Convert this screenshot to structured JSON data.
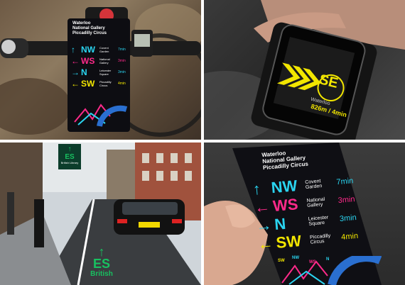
{
  "panel_bike": {
    "route": [
      "Waterloo",
      "National Gallery",
      "Piccadilly Circus"
    ],
    "directions": [
      {
        "arrow": "up-arrow",
        "code": "NW",
        "dest": "Covent Garden",
        "time": "7min",
        "color": "#2ad4f0"
      },
      {
        "arrow": "left-arrow",
        "code": "WS",
        "dest": "National Gallery",
        "time": "3min",
        "color": "#ff2a8a"
      },
      {
        "arrow": "right-arrow",
        "code": "N",
        "dest": "Leicester Square",
        "time": "3min",
        "color": "#2ad4f0"
      },
      {
        "arrow": "left-arrow",
        "code": "SW",
        "dest": "Piccadilly Circus",
        "time": "4min",
        "color": "#f2e600"
      }
    ]
  },
  "panel_phone": {
    "direction": "SE",
    "destination": "Waterloo",
    "distance": "826m / 4min"
  },
  "panel_street": {
    "sign_code": "ES",
    "sign_text": "British Library",
    "road_code": "ES",
    "road_text": "British"
  },
  "panel_card": {
    "route": [
      "Waterloo",
      "National Gallery",
      "Piccadilly Circus"
    ],
    "directions": [
      {
        "code": "NW",
        "dest": "Covent Garden",
        "time": "7min",
        "color": "#2ad4f0"
      },
      {
        "code": "WS",
        "dest": "National Gallery",
        "time": "3min",
        "color": "#ff2a8a"
      },
      {
        "code": "N",
        "dest": "Leicester Square",
        "time": "3min",
        "color": "#2ad4f0"
      },
      {
        "code": "SW",
        "dest": "Piccadilly Circus",
        "time": "4min",
        "color": "#f2e600"
      }
    ],
    "map_labels": [
      "SW",
      "NW",
      "WS",
      "N"
    ]
  }
}
